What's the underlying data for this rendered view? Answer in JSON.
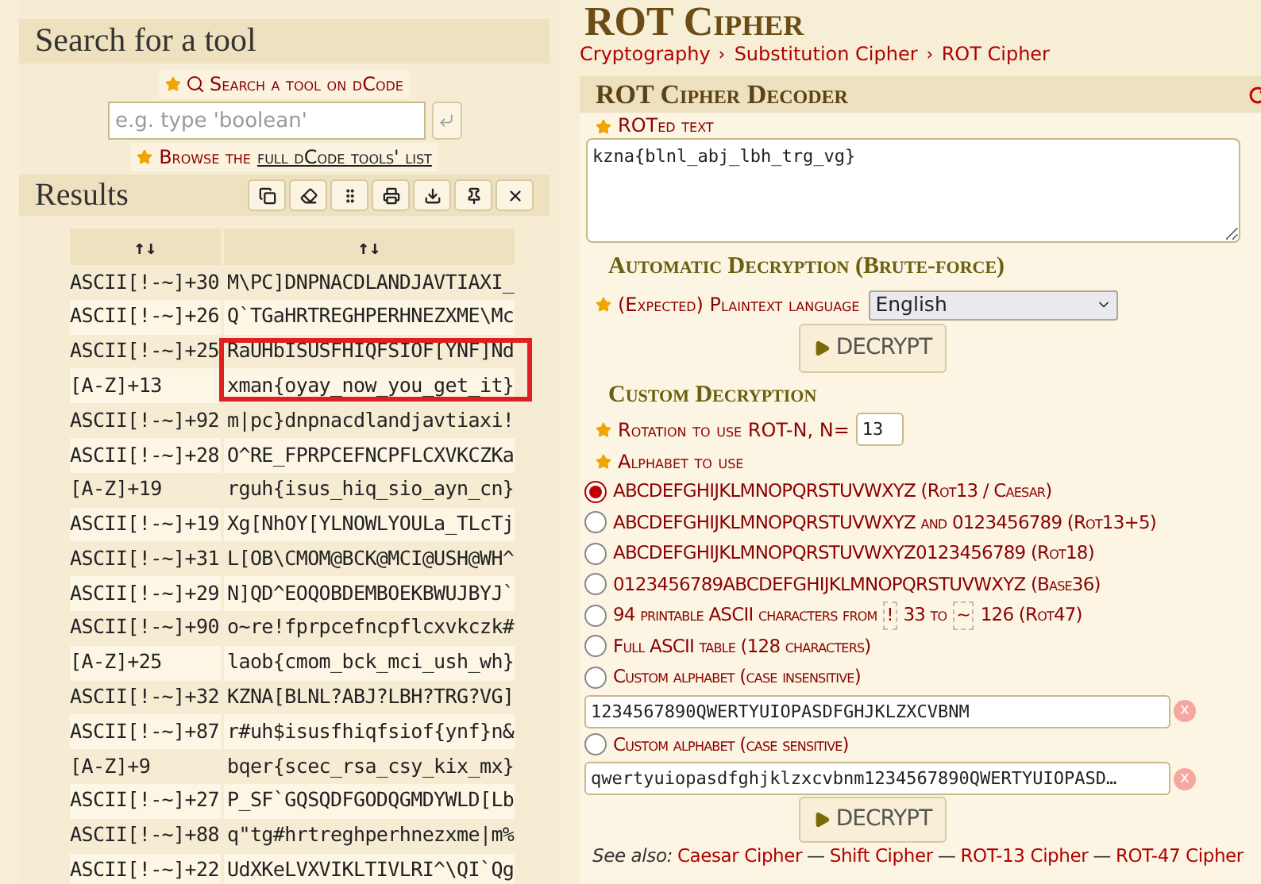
{
  "search_panel": {
    "title": "Search for a tool",
    "search_link": "Search a tool on dCode",
    "search_field": {
      "placeholder": "e.g. type 'boolean'"
    },
    "browse": {
      "prefix": "Browse the",
      "link": "full dCode tools' list"
    }
  },
  "results": {
    "title": "Results",
    "columns": [
      "↑↓",
      "↑↓"
    ],
    "rows": [
      {
        "method": "ASCII[!-~]+30",
        "text": "M\\PC]DNPNACDLANDJAVTIAXI_"
      },
      {
        "method": "ASCII[!-~]+26",
        "text": "Q`TGaHRTREGHPERHNEZXME\\Mc"
      },
      {
        "method": "ASCII[!-~]+25",
        "text": "RaUHbISUSFHIQFSIOF[YNF]Nd"
      },
      {
        "method": "[A-Z]+13",
        "text": "xman{oyay_now_you_get_it}"
      },
      {
        "method": "ASCII[!-~]+92",
        "text": "m|pc}dnpnacdlandjavtiaxi!"
      },
      {
        "method": "ASCII[!-~]+28",
        "text": "O^RE_FPRPCEFNCPFLCXVKCZKa"
      },
      {
        "method": "[A-Z]+19",
        "text": "rguh{isus_hiq_sio_ayn_cn}"
      },
      {
        "method": "ASCII[!-~]+19",
        "text": "Xg[NhOY[YLNOWLYOULa_TLcTj"
      },
      {
        "method": "ASCII[!-~]+31",
        "text": "L[OB\\CMOM@BCK@MCI@USH@WH^"
      },
      {
        "method": "ASCII[!-~]+29",
        "text": "N]QD^EOQOBDEMBOEKBWUJBYJ`"
      },
      {
        "method": "ASCII[!-~]+90",
        "text": "o~re!fprpcefncpflcxvkczk#"
      },
      {
        "method": "[A-Z]+25",
        "text": "laob{cmom_bck_mci_ush_wh}"
      },
      {
        "method": "ASCII[!-~]+32",
        "text": "KZNA[BLNL?ABJ?LBH?TRG?VG]"
      },
      {
        "method": "ASCII[!-~]+87",
        "text": "r#uh$isusfhiqfsiof{ynf}n&"
      },
      {
        "method": "[A-Z]+9",
        "text": "bqer{scec_rsa_csy_kix_mx}"
      },
      {
        "method": "ASCII[!-~]+27",
        "text": "P_SF`GQSQDFGODQGMDYWLD[Lb"
      },
      {
        "method": "ASCII[!-~]+88",
        "text": "q\"tg#hrtreghperhnezxme|m%"
      },
      {
        "method": "ASCII[!-~]+22",
        "text": "UdXKeLVXVIKLTIVLRI^\\QI`Qg"
      }
    ]
  },
  "page": {
    "title": "ROT Cipher",
    "breadcrumb": [
      "Cryptography",
      "Substitution Cipher",
      "ROT Cipher"
    ]
  },
  "decoder": {
    "title": "ROT Cipher Decoder",
    "input_label": "ROTed text",
    "input_value": "kzna{blnl_abj_lbh_trg_vg}",
    "auto_title": "Automatic Decryption (Brute-force)",
    "language_label": "(Expected) Plaintext language",
    "language": "English",
    "decrypt_button": "DECRYPT",
    "custom_title": "Custom Decryption",
    "rotation_label": "Rotation to use ROT-N, N=",
    "rotation": "13",
    "alphabet_label": "Alphabet to use",
    "alphabets": [
      {
        "selected": true,
        "parts": [
          {
            "kind": "text",
            "text": "ABCDEFGHIJKLMNOPQRSTUVWXYZ (Rot13 / Caesar)"
          }
        ]
      },
      {
        "selected": false,
        "parts": [
          {
            "kind": "text",
            "text": "ABCDEFGHIJKLMNOPQRSTUVWXYZ and 0123456789 (Rot13+5)"
          }
        ]
      },
      {
        "selected": false,
        "parts": [
          {
            "kind": "text",
            "text": "ABCDEFGHIJKLMNOPQRSTUVWXYZ0123456789 (Rot18)"
          }
        ]
      },
      {
        "selected": false,
        "parts": [
          {
            "kind": "text",
            "text": "0123456789ABCDEFGHIJKLMNOPQRSTUVWXYZ (Base36)"
          }
        ]
      },
      {
        "selected": false,
        "parts": [
          {
            "kind": "text",
            "text": "94 printable ASCII characters from"
          },
          {
            "kind": "char",
            "text": "!"
          },
          {
            "kind": "text",
            "text": "33 to"
          },
          {
            "kind": "char",
            "text": "~"
          },
          {
            "kind": "text",
            "text": "126 (Rot47)"
          }
        ]
      },
      {
        "selected": false,
        "parts": [
          {
            "kind": "text",
            "text": "Full ASCII table (128 characters)"
          }
        ]
      },
      {
        "selected": false,
        "parts": [
          {
            "kind": "text",
            "text": "Custom alphabet (case insensitive)"
          }
        ],
        "value": "1234567890QWERTYUIOPASDFGHJKLZXCVBNM",
        "clear": "x"
      },
      {
        "selected": false,
        "parts": [
          {
            "kind": "text",
            "text": "Custom alphabet (case sensitive)"
          }
        ],
        "value": "qwertyuiopasdfghjklzxcvbnm1234567890QWERTYUIOPASD…",
        "clear": "x"
      }
    ],
    "decrypt_button_2": "DECRYPT"
  },
  "see_also": {
    "label": "See also:",
    "items": [
      {
        "kind": "link",
        "text": "Caesar Cipher"
      },
      {
        "kind": "separator",
        "text": "—"
      },
      {
        "kind": "link",
        "text": "Shift Cipher"
      },
      {
        "kind": "separator",
        "text": "—"
      },
      {
        "kind": "link",
        "text": "ROT-13 Cipher"
      },
      {
        "kind": "separator",
        "text": "—"
      },
      {
        "kind": "link",
        "text": "ROT-47 Cipher"
      }
    ]
  }
}
